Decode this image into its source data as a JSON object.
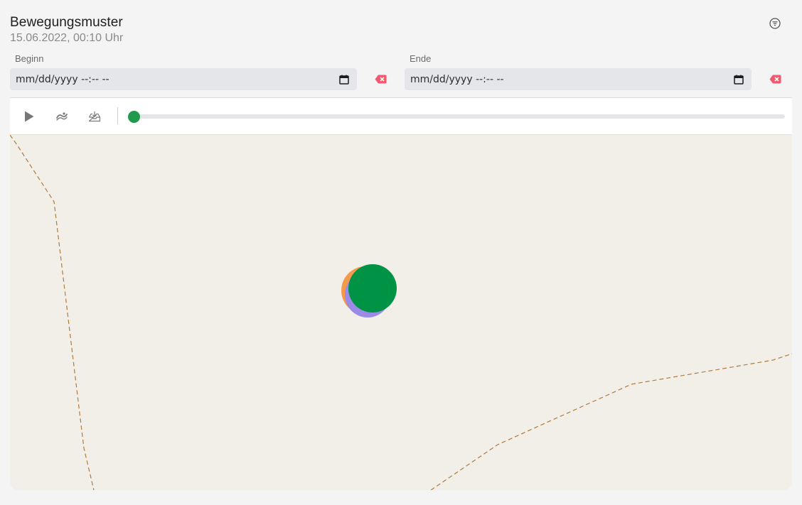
{
  "header": {
    "title": "Bewegungsmuster",
    "subtitle": "15.06.2022, 00:10 Uhr",
    "filter_icon": "filter-icon"
  },
  "range": {
    "start": {
      "label": "Beginn",
      "value": "mm/dd/yyyy --:-- --"
    },
    "end": {
      "label": "Ende",
      "value": "mm/dd/yyyy --:-- --"
    },
    "clear_icon": "backspace-x-icon",
    "calendar_icon": "calendar-icon"
  },
  "toolbar": {
    "play_icon": "play-icon",
    "route_icon": "route-icon",
    "export_icon": "inbox-download-icon",
    "timeline_progress": 0.0,
    "accent": "#1f9a4e"
  },
  "map": {
    "background": "#f2efe9",
    "boundary_color": "#b07a3c",
    "markers": [
      {
        "color": "#f59a4a"
      },
      {
        "color": "#9b8be6"
      },
      {
        "color": "#009245"
      }
    ]
  }
}
